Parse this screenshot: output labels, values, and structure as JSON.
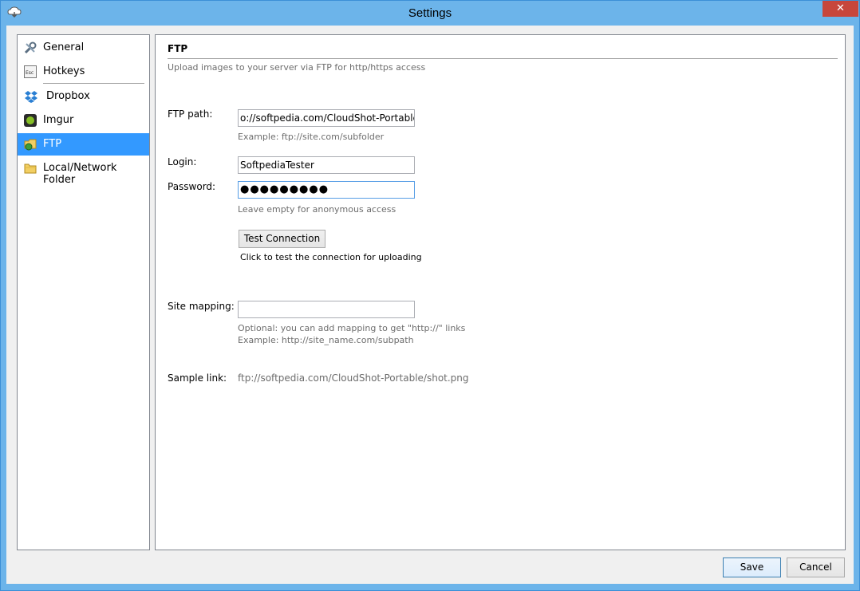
{
  "window": {
    "title": "Settings",
    "close_glyph": "✕",
    "icon": "cloud-icon"
  },
  "sidebar": {
    "items": [
      {
        "label": "General",
        "icon": "wrench-icon"
      },
      {
        "label": "Hotkeys",
        "icon": "esc-key-icon"
      },
      {
        "label": "Dropbox",
        "icon": "dropbox-icon"
      },
      {
        "label": "Imgur",
        "icon": "imgur-icon"
      },
      {
        "label": "FTP",
        "icon": "ftp-icon",
        "selected": true
      },
      {
        "label": "Local/Network Folder",
        "icon": "folder-icon"
      }
    ]
  },
  "ftp": {
    "heading": "FTP",
    "subtitle": "Upload images to your server via FTP for http/https access",
    "path_label": "FTP path:",
    "path_value": "o://softpedia.com/CloudShot-Portable",
    "path_hint": "Example: ftp://site.com/subfolder",
    "login_label": "Login:",
    "login_value": "SoftpediaTester",
    "password_label": "Password:",
    "password_value": "●●●●●●●●●",
    "password_hint": "Leave empty for anonymous access",
    "test_button": "Test Connection",
    "test_note": "Click to test the connection for uploading",
    "mapping_label": "Site mapping:",
    "mapping_value": "",
    "mapping_hint_1": "Optional: you can add mapping to get \"http://\" links",
    "mapping_hint_2": "Example: http://site_name.com/subpath",
    "sample_label": "Sample link:",
    "sample_value": "ftp://softpedia.com/CloudShot-Portable/shot.png"
  },
  "footer": {
    "save": "Save",
    "cancel": "Cancel"
  },
  "colors": {
    "accent": "#3399ff",
    "titlebar": "#6cb4ea",
    "close": "#c7463c"
  }
}
